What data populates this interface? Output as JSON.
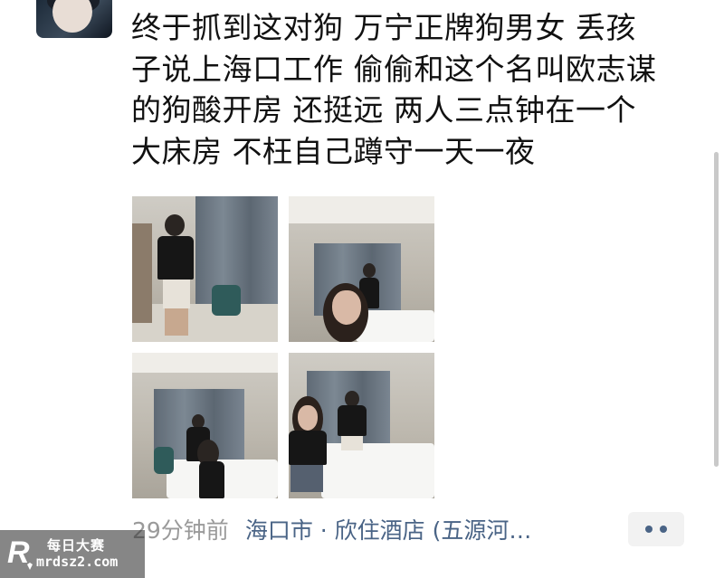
{
  "post": {
    "text_lines": [
      "终于抓到这对狗 万宁正牌狗男女 丢孩",
      "子说上海口工作 偷偷和这个名叫欧志谋",
      "的狗酸开房 还挺远 两人三点钟在一个",
      "大床房 不枉自己蹲守一天一夜"
    ],
    "time": "29分钟前",
    "location": "海口市 · 欣住酒店 (五源河…"
  },
  "watermark": {
    "line1": "每日大赛",
    "line2": "mrdsz2.com"
  },
  "icons": {
    "more": "more-dots-icon",
    "logo": "site-logo-icon"
  },
  "colors": {
    "link": "#4a6486",
    "time": "#9a9a9a",
    "text": "#111111"
  }
}
